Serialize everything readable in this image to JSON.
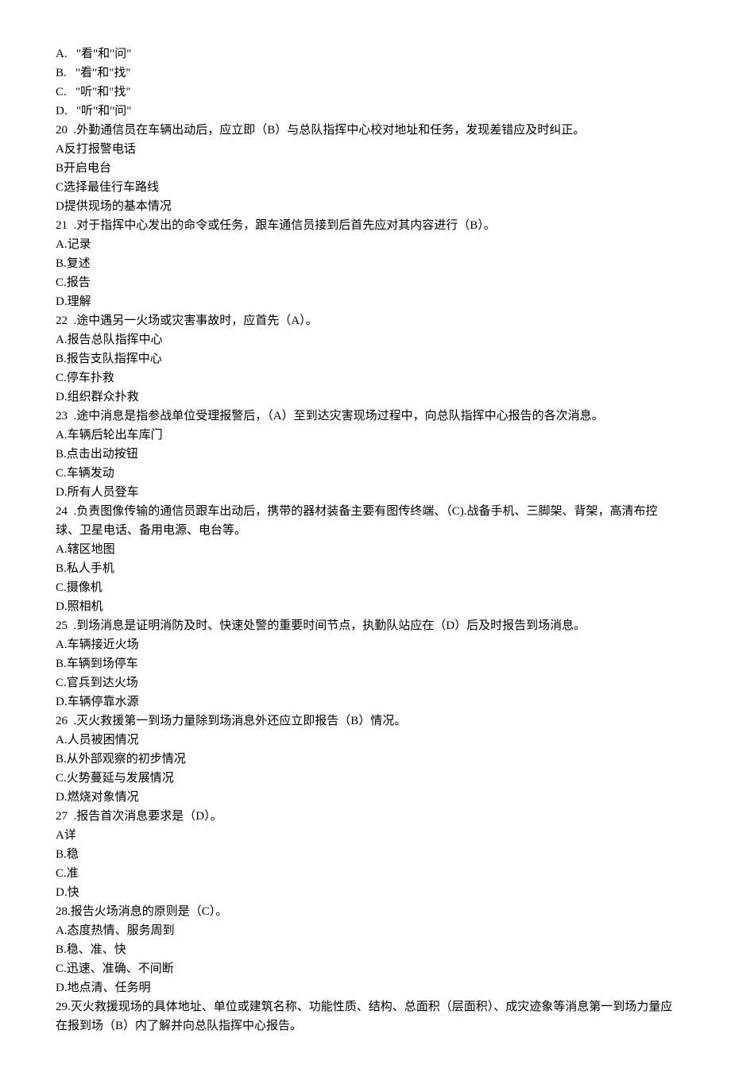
{
  "lines": [
    "A.   \"看\"和\"问\"",
    "B.   \"看\"和\"找\"",
    "C.   \"听\"和\"找\"",
    "D.   \"听\"和\"问\"",
    "20  .外勤通信员在车辆出动后，应立即（B）与总队指挥中心校对地址和任务，发现差错应及时纠正。",
    "A反打报警电话",
    "B开启电台",
    "C选择最佳行车路线",
    "D提供现场的基本情况",
    "21  .对于指挥中心发出的命令或任务，跟车通信员接到后首先应对其内容进行（B）。",
    "A.记录",
    "B.复述",
    "C.报告",
    "D.理解",
    "22  .途中遇另一火场或灾害事故时，应首先（A）。",
    "A.报告总队指挥中心",
    "B.报告支队指挥中心",
    "C.停车扑救",
    "D.组织群众扑救",
    "23  .途中消息是指参战单位受理报警后，（A）至到达灾害现场过程中，向总队指挥中心报告的各次消息。",
    "A.车辆后轮出车库门",
    "B.点击出动按钮",
    "C.车辆发动",
    "D.所有人员登车",
    "24  .负责图像传输的通信员跟车出动后，携带的器材装备主要有图传终端、（C).战备手机、三脚架、背架，高清布控球、卫星电话、备用电源、电台等。",
    "A.辖区地图",
    "B.私人手机",
    "C.摄像机",
    "D.照相机",
    "25  .到场消息是证明消防及时、快速处警的重要时间节点，执勤队站应在（D）后及时报告到场消息。",
    "A.车辆接近火场",
    "B.车辆到场停车",
    "C.官兵到达火场",
    "D.车辆停靠水源",
    "26  .灭火救援第一到场力量除到场消息外还应立即报告（B）情况。",
    "A.人员被困情况",
    "B.从外部观察的初步情况",
    "C.火势蔓延与发展情况",
    "D.燃烧对象情况",
    "27  .报告首次消息要求是（D）。",
    "A详",
    "B.稳",
    "C.准",
    "D.快",
    "28.报告火场消息的原则是（C）。",
    "A.态度热情、服务周到",
    "B.稳、准、快",
    "C.迅速、准确、不间断",
    "D.地点清、任务明",
    "29.灭火救援现场的具体地址、单位或建筑名称、功能性质、结构、总面积（层面积）、成灾迹象等消息第一到场力量应在报到场（B）内了解并向总队指挥中心报告。"
  ]
}
